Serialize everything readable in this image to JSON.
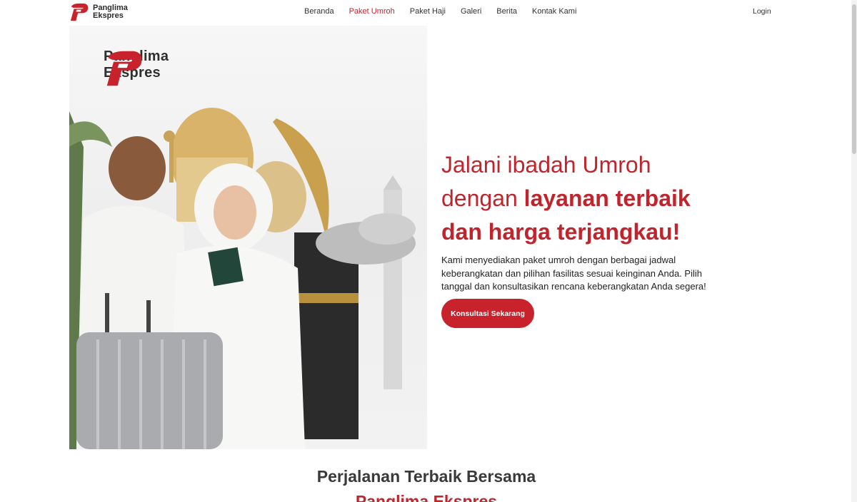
{
  "brand": {
    "line1": "Panglima",
    "line2": "Ekspres",
    "accent_color": "#c8232c"
  },
  "nav": {
    "items": [
      {
        "label": "Beranda",
        "active": false
      },
      {
        "label": "Paket Umroh",
        "active": true
      },
      {
        "label": "Paket Haji",
        "active": false
      },
      {
        "label": "Galeri",
        "active": false
      },
      {
        "label": "Berita",
        "active": false
      },
      {
        "label": "Kontak Kami",
        "active": false
      }
    ],
    "login_label": "Login"
  },
  "hero": {
    "logo_line1": "Panglima",
    "logo_line2": "Ekspres",
    "headline_line1": "Jalani ibadah Umroh",
    "headline_plain2": "dengan ",
    "headline_bold2": "layanan terbaik",
    "headline_bold3": "dan harga terjangkau!",
    "description": "Kami menyediakan paket umroh dengan berbagai jadwal keberangkatan dan pilihan fasilitas sesuai keinginan Anda. Pilih tanggal dan konsultasikan rencana keberangkatan Anda segera!",
    "cta_label": "Konsultasi Sekarang",
    "image_alt": "couple-pilgrims-with-suitcase-and-kaaba"
  },
  "section": {
    "title": "Perjalanan Terbaik Bersama",
    "subtitle": "Panglima Ekspres"
  }
}
